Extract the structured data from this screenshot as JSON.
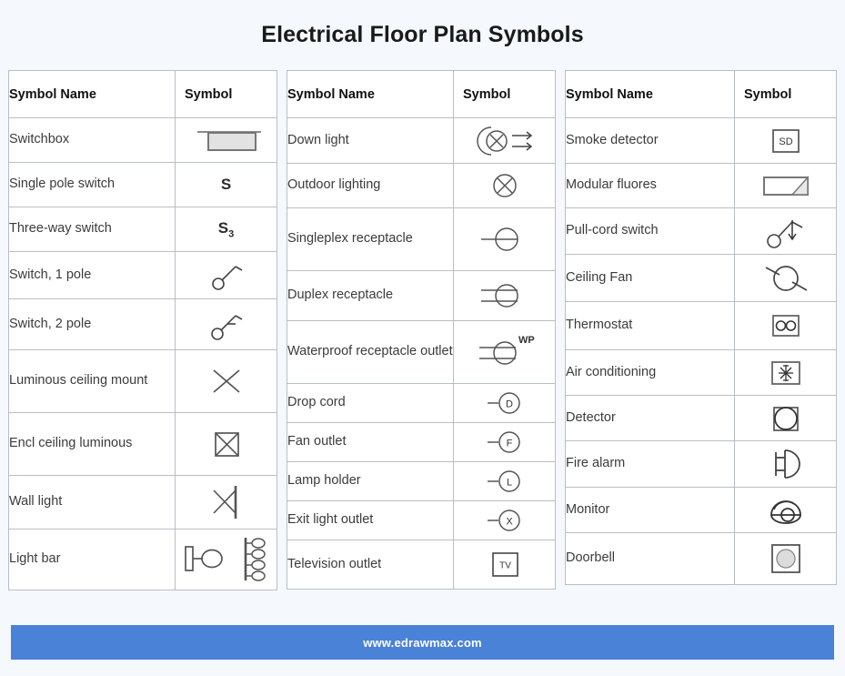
{
  "page": {
    "title": "Electrical Floor Plan Symbols",
    "background_color": "#f5f8fd",
    "accent_color": "#4a82d8"
  },
  "footer": {
    "text": "www.edrawmax.com",
    "background_color": "#4a82d8",
    "text_color": "#ffffff"
  },
  "tables": [
    {
      "headers": {
        "name": "Symbol Name",
        "symbol": "Symbol"
      },
      "rows": [
        {
          "name": "Switchbox",
          "symbol_icon": "switchbox-icon"
        },
        {
          "name": "Single pole switch",
          "symbol_icon": "single-pole-switch-icon",
          "symbol_text": "S"
        },
        {
          "name": "Three-way switch",
          "symbol_icon": "three-way-switch-icon",
          "symbol_text": "S3"
        },
        {
          "name": "Switch, 1 pole",
          "symbol_icon": "switch-1-pole-icon"
        },
        {
          "name": "Switch, 2 pole",
          "symbol_icon": "switch-2-pole-icon"
        },
        {
          "name": "Luminous ceiling mount",
          "symbol_icon": "luminous-ceiling-mount-icon"
        },
        {
          "name": "Encl ceiling luminous",
          "symbol_icon": "encl-ceiling-luminous-icon"
        },
        {
          "name": "Wall light",
          "symbol_icon": "wall-light-icon"
        },
        {
          "name": "Light bar",
          "symbol_icon": "light-bar-icon"
        }
      ]
    },
    {
      "headers": {
        "name": "Symbol Name",
        "symbol": "Symbol"
      },
      "rows": [
        {
          "name": "Down light",
          "symbol_icon": "down-light-icon"
        },
        {
          "name": "Outdoor lighting",
          "symbol_icon": "outdoor-lighting-icon"
        },
        {
          "name": "Singleplex receptacle",
          "symbol_icon": "singleplex-receptacle-icon"
        },
        {
          "name": "Duplex receptacle",
          "symbol_icon": "duplex-receptacle-icon"
        },
        {
          "name": "Waterproof receptacle outlet",
          "symbol_icon": "waterproof-receptacle-outlet-icon",
          "symbol_text": "WP"
        },
        {
          "name": "Drop cord",
          "symbol_icon": "drop-cord-icon",
          "symbol_text": "D"
        },
        {
          "name": "Fan outlet",
          "symbol_icon": "fan-outlet-icon",
          "symbol_text": "F"
        },
        {
          "name": "Lamp holder",
          "symbol_icon": "lamp-holder-icon",
          "symbol_text": "L"
        },
        {
          "name": "Exit light outlet",
          "symbol_icon": "exit-light-outlet-icon",
          "symbol_text": "X"
        },
        {
          "name": "Television outlet",
          "symbol_icon": "television-outlet-icon",
          "symbol_text": "TV"
        }
      ]
    },
    {
      "headers": {
        "name": "Symbol Name",
        "symbol": "Symbol"
      },
      "rows": [
        {
          "name": "Smoke detector",
          "symbol_icon": "smoke-detector-icon",
          "symbol_text": "SD"
        },
        {
          "name": "Modular fluores",
          "symbol_icon": "modular-fluores-icon"
        },
        {
          "name": "Pull-cord switch",
          "symbol_icon": "pull-cord-switch-icon"
        },
        {
          "name": "Ceiling Fan",
          "symbol_icon": "ceiling-fan-icon"
        },
        {
          "name": "Thermostat",
          "symbol_icon": "thermostat-icon"
        },
        {
          "name": "Air conditioning",
          "symbol_icon": "air-conditioning-icon"
        },
        {
          "name": "Detector",
          "symbol_icon": "detector-icon"
        },
        {
          "name": "Fire alarm",
          "symbol_icon": "fire-alarm-icon"
        },
        {
          "name": "Monitor",
          "symbol_icon": "monitor-icon"
        },
        {
          "name": "Doorbell",
          "symbol_icon": "doorbell-icon"
        }
      ]
    }
  ]
}
